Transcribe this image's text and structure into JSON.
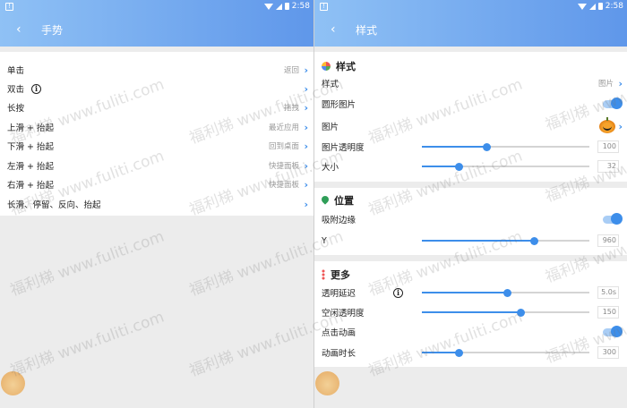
{
  "status": {
    "time": "2:58"
  },
  "left": {
    "title": "手势",
    "rows": [
      {
        "label": "单击",
        "value": "返回"
      },
      {
        "label": "双击",
        "value": ""
      },
      {
        "label": "长按",
        "value": "拖拽"
      },
      {
        "label": "上滑 + 抬起",
        "value": "最近应用"
      },
      {
        "label": "下滑 + 抬起",
        "value": "回到桌面"
      },
      {
        "label": "左滑 + 抬起",
        "value": "快捷面板"
      },
      {
        "label": "右滑 + 抬起",
        "value": "快捷面板"
      },
      {
        "label": "长滑、停留、反向、抬起",
        "value": ""
      }
    ]
  },
  "right": {
    "title": "样式",
    "style_section": {
      "header": "样式",
      "style_label": "样式",
      "style_value": "图片",
      "round_label": "圆形图片",
      "round_on": true,
      "image_label": "图片",
      "opacity_label": "图片透明度",
      "opacity_value": "100",
      "opacity_fraction": 0.39,
      "size_label": "大小",
      "size_value": "32",
      "size_fraction": 0.22
    },
    "position_section": {
      "header": "位置",
      "snap_label": "吸附边缘",
      "snap_on": true,
      "y_label": "Y",
      "y_value": "960",
      "y_fraction": 0.67
    },
    "more_section": {
      "header": "更多",
      "delay_label": "透明延迟",
      "delay_value": "5.0s",
      "delay_fraction": 0.51,
      "idle_label": "空闲透明度",
      "idle_value": "150",
      "idle_fraction": 0.59,
      "anim_label": "点击动画",
      "anim_on": true,
      "duration_label": "动画时长",
      "duration_value": "300",
      "duration_fraction": 0.22
    }
  },
  "watermark": {
    "cn": "福利梯",
    "en": "www.fuliti.com"
  },
  "colors": {
    "accent": "#3d8eea",
    "appbar_start": "#8fc1f5",
    "appbar_end": "#5f97ea"
  }
}
